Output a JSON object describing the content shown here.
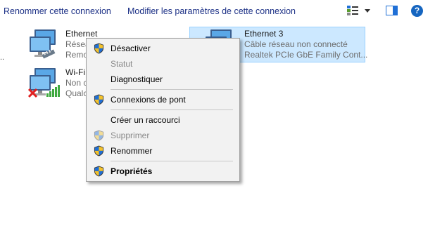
{
  "commandbar": {
    "rename_label": "Renommer cette connexion",
    "modify_label": "Modifier les paramètres de cette connexion",
    "help_glyph": "?"
  },
  "list": {
    "overflow_dots": "..",
    "connections": [
      {
        "name": "Ethernet",
        "line1": "Résea",
        "line2": "Remo"
      },
      {
        "name": "Wi-Fi",
        "line1": "Non c",
        "line2": "Qualc"
      },
      {
        "name": "Ethernet 3",
        "line1": "Câble réseau non connecté",
        "line2": "Realtek PCIe GbE Family Cont..."
      }
    ]
  },
  "context_menu": {
    "items": [
      {
        "label": "Désactiver",
        "shield": true,
        "enabled": true
      },
      {
        "label": "Statut",
        "shield": false,
        "enabled": false
      },
      {
        "label": "Diagnostiquer",
        "shield": false,
        "enabled": true
      },
      {
        "label": "Connexions de pont",
        "shield": true,
        "enabled": true
      },
      {
        "label": "Créer un raccourci",
        "shield": false,
        "enabled": true
      },
      {
        "label": "Supprimer",
        "shield": true,
        "enabled": false
      },
      {
        "label": "Renommer",
        "shield": true,
        "enabled": true
      },
      {
        "label": "Propriétés",
        "shield": true,
        "enabled": true,
        "default": true
      }
    ]
  },
  "icons": {
    "shield": "uac-shield-icon",
    "network": "network-adapter-icon",
    "help": "help-icon"
  },
  "colors": {
    "link_blue": "#1e3287",
    "selection_fill": "#cce8ff",
    "selection_border": "#99d1ff",
    "menu_bg": "#f2f2f2",
    "disabled_text": "#8a8a8a",
    "help_blue": "#1565c0"
  }
}
